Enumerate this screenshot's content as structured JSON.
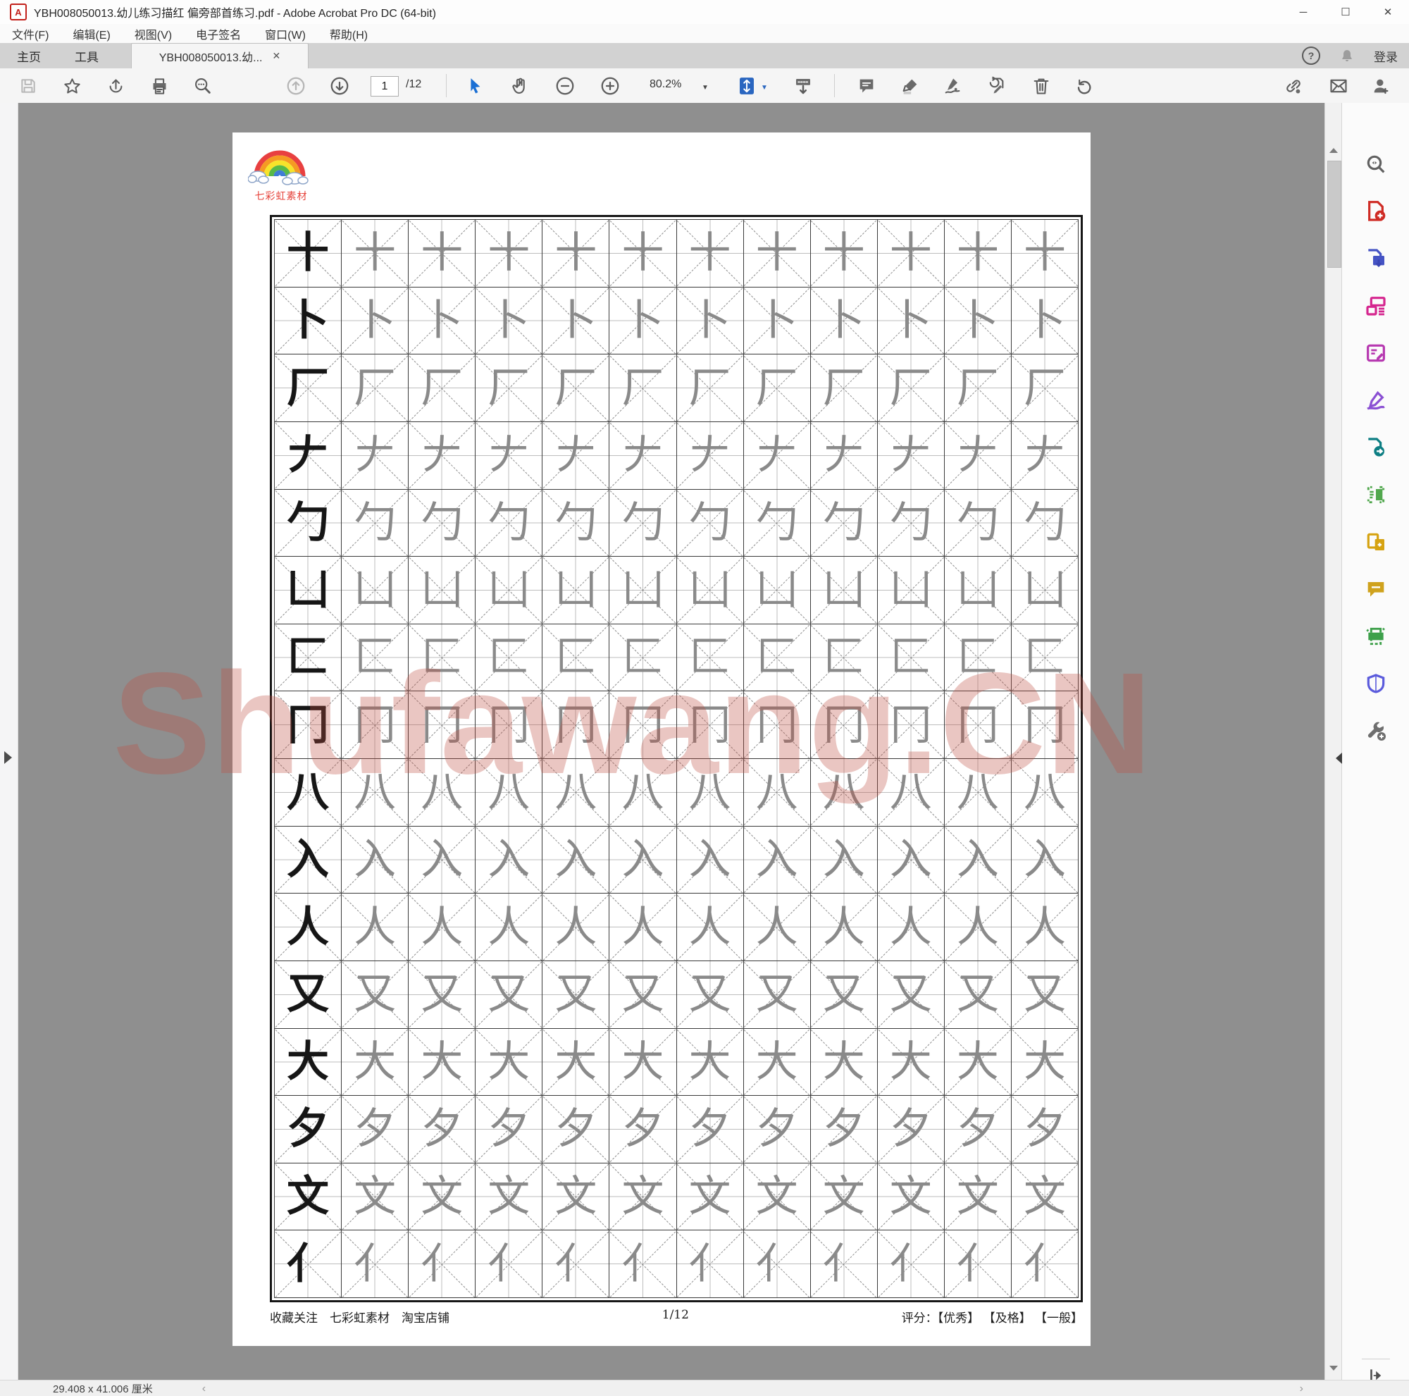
{
  "window": {
    "title": "YBH008050013.幼儿练习描红 偏旁部首练习.pdf - Adobe Acrobat Pro DC (64-bit)",
    "pdf_badge": "A",
    "controls": {
      "minimize": "─",
      "maximize": "☐",
      "close": "✕"
    }
  },
  "menubar": {
    "items": [
      "文件(F)",
      "编辑(E)",
      "视图(V)",
      "电子签名",
      "窗口(W)",
      "帮助(H)"
    ]
  },
  "tabbar": {
    "home": "主页",
    "tools": "工具",
    "document_tab": "YBH008050013.幼...",
    "close": "✕",
    "help": "?",
    "login": "登录"
  },
  "toolbar": {
    "page_number": "1",
    "page_total": "/12",
    "zoom_value": "80.2%",
    "zoom_caret": "▼",
    "fit_caret": "▼"
  },
  "page": {
    "logo_caption": "七彩虹素材",
    "watermark": "Shufawang.CN",
    "grid": {
      "columns": 12,
      "characters": [
        "十",
        "卜",
        "厂",
        "𠂇",
        "勹",
        "凵",
        "匚",
        "冂",
        "八",
        "入",
        "人",
        "又",
        "大",
        "夕",
        "文",
        "亻"
      ]
    },
    "footer": {
      "left": "收藏关注　七彩虹素材　淘宝店铺",
      "center": "1/12",
      "right": "评分：【优秀】 【及格】 【一般】"
    }
  },
  "sidebar": {
    "tools": [
      "search",
      "create-pdf",
      "export-pdf",
      "organize-pages",
      "edit-pdf",
      "fill-and-sign",
      "send-for-review",
      "scan-ocr",
      "combine-files",
      "comment",
      "print-production",
      "protect",
      "more-tools"
    ]
  },
  "statusbar": {
    "dimensions": "29.408 x 41.006 厘米",
    "chevron_left": "‹",
    "chevron_right": "›"
  }
}
